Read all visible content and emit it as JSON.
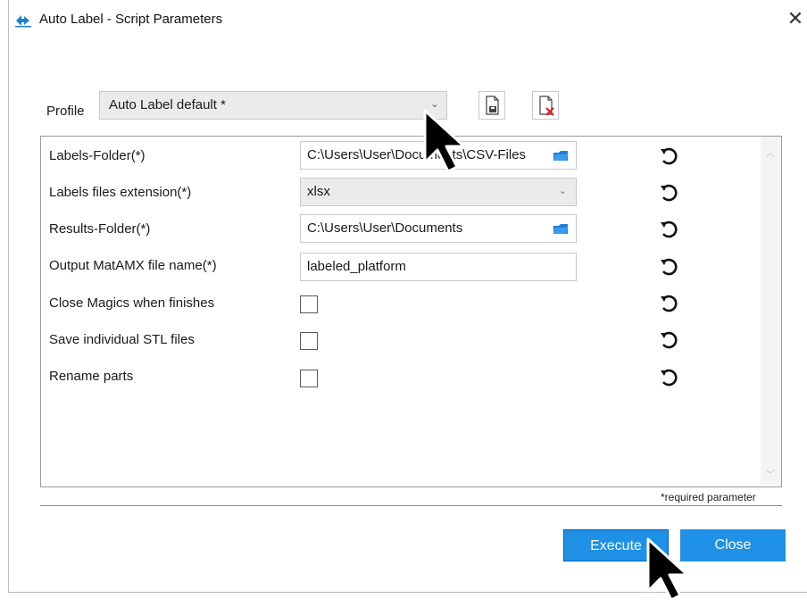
{
  "window": {
    "title": "Auto Label - Script Parameters"
  },
  "profile": {
    "label": "Profile",
    "value": "Auto Label default *"
  },
  "params": [
    {
      "label": "Labels-Folder(*)",
      "type": "folder",
      "value": "C:\\Users\\User\\Documents\\CSV-Files"
    },
    {
      "label": "Labels files extension(*)",
      "type": "select",
      "value": "xlsx"
    },
    {
      "label": "Results-Folder(*)",
      "type": "folder",
      "value": "C:\\Users\\User\\Documents"
    },
    {
      "label": "Output MatAMX file name(*)",
      "type": "text",
      "value": "labeled_platform"
    },
    {
      "label": "Close Magics when finishes",
      "type": "checkbox",
      "checked": false
    },
    {
      "label": "Save individual STL files",
      "type": "checkbox",
      "checked": false
    },
    {
      "label": "Rename parts",
      "type": "checkbox",
      "checked": false
    }
  ],
  "footer": {
    "required_note": "*required parameter"
  },
  "buttons": {
    "execute": "Execute",
    "close": "Close"
  },
  "colors": {
    "button_blue": "#1e90e6",
    "folder_blue": "#1e7fd8"
  }
}
